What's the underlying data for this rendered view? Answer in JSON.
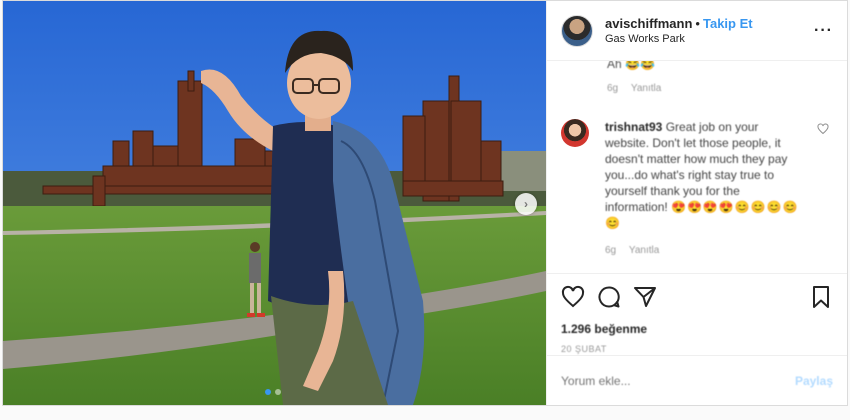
{
  "post": {
    "username": "avischiffmann",
    "separator": "•",
    "follow_label": "Takip Et",
    "location": "Gas Works Park",
    "more_label": "···"
  },
  "comments": {
    "previous": {
      "text": "Ah 😂😂",
      "time": "6g",
      "reply_label": "Yanıtla"
    },
    "items": [
      {
        "username": "trishnat93",
        "text": "Great job on your website. Don't let those people, it doesn't matter how much they pay you...do what's right stay true to yourself thank you for the information!",
        "emojis": "😍😍😍😍😊😊😊😊😊",
        "time": "6g",
        "reply_label": "Yanıtla"
      }
    ]
  },
  "actions": {
    "likes": "1.296 beğenme",
    "date": "20 ŞUBAT",
    "comment_placeholder": "Yorum ekle...",
    "post_label": "Paylaş"
  },
  "media": {
    "next_label": "›",
    "slide_count": 2,
    "active_slide": 1
  },
  "colors": {
    "accent": "#3897f0",
    "sky": "#2f6fd6",
    "grass": "#4d8a2a",
    "path": "#9a958c",
    "rust": "#7a3a22"
  }
}
